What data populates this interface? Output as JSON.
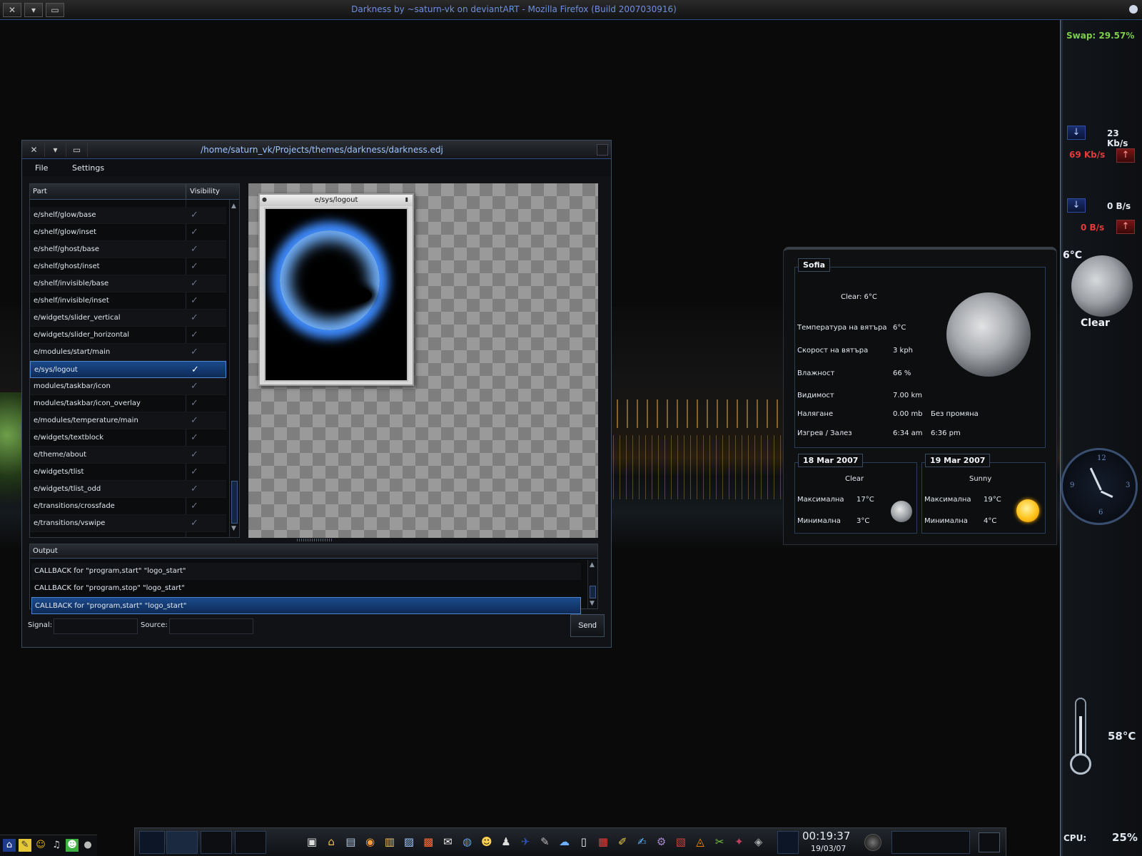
{
  "browser": {
    "title": "Darkness by ~saturn-vk on deviantART - Mozilla Firefox (Build 2007030916)"
  },
  "sidebar": {
    "swap": "Swap: 29.57%",
    "net1_down": "23 Kb/s",
    "net1_up": "69 Kb/s",
    "net2_down": "0 B/s",
    "net2_up": "0 B/s",
    "weather_temp": "6°C",
    "weather_cond": "Clear",
    "clock_numbers": [
      "12",
      "3",
      "6",
      "9"
    ],
    "cpu_temp": "58°C",
    "cpu_label": "CPU:",
    "cpu_value": "25%"
  },
  "editor": {
    "title": "/home/saturn_vk/Projects/themes/darkness/darkness.edj",
    "menu": {
      "file": "File",
      "settings": "Settings"
    },
    "parts": {
      "col_part": "Part",
      "col_visibility": "Visibility",
      "check": "✓",
      "items": [
        "e/shelf/glow/base",
        "e/shelf/glow/inset",
        "e/shelf/ghost/base",
        "e/shelf/ghost/inset",
        "e/shelf/invisible/base",
        "e/shelf/invisible/inset",
        "e/widgets/slider_vertical",
        "e/widgets/slider_horizontal",
        "e/modules/start/main",
        "e/sys/logout",
        "modules/taskbar/icon",
        "modules/taskbar/icon_overlay",
        "e/modules/temperature/main",
        "e/widgets/textblock",
        "e/theme/about",
        "e/widgets/tlist",
        "e/widgets/tlist_odd",
        "e/transitions/crossfade",
        "e/transitions/vswipe"
      ],
      "selected": "e/sys/logout"
    },
    "preview": {
      "title": "e/sys/logout"
    },
    "output": {
      "header": "Output",
      "lines": [
        "CALLBACK for \"program,start\" \"logo_start\"",
        "CALLBACK for \"program,stop\" \"logo_start\"",
        "CALLBACK for \"program,start\" \"logo_start\""
      ]
    },
    "signal_label": "Signal:",
    "source_label": "Source:",
    "signal_value": "",
    "source_value": "",
    "send_label": "Send"
  },
  "weather": {
    "city": "Sofia",
    "current": "Clear: 6°C",
    "rows": [
      {
        "label": "Температура на вятъра",
        "value": "6°C"
      },
      {
        "label": "Скорост на вятъра",
        "value": "3 kph"
      },
      {
        "label": "Влажност",
        "value": "66 %"
      },
      {
        "label": "Видимост",
        "value": "7.00 km"
      },
      {
        "label": "Налягане",
        "value": "0.00 mb",
        "extra": "Без промяна"
      },
      {
        "label": "Изгрев / Залез",
        "value": "6:34 am",
        "extra": "6:36 pm"
      }
    ],
    "forecast": [
      {
        "date": "18 Mar 2007",
        "cond": "Clear",
        "max_label": "Максимална",
        "max": "17°C",
        "min_label": "Минимална",
        "min": "3°C"
      },
      {
        "date": "19 Mar 2007",
        "cond": "Sunny",
        "max_label": "Максимална",
        "max": "19°C",
        "min_label": "Минимална",
        "min": "4°C"
      }
    ]
  },
  "taskbar": {
    "time": "00:19:37",
    "date": "19/03/07",
    "launchers": [
      "terminal-icon",
      "home-icon",
      "filemanager-icon",
      "media-icon",
      "book-icon",
      "image-viewer-icon",
      "photo-icon",
      "mail-icon",
      "browser-icon",
      "chat-icon",
      "user-icon",
      "ftp-icon",
      "notes-icon",
      "skype-icon",
      "document-icon",
      "presentation-icon",
      "editor-icon",
      "writer-icon",
      "settings-icon",
      "package-icon",
      "vlc-icon",
      "tool-icon",
      "game-icon",
      "generic-icon"
    ]
  }
}
